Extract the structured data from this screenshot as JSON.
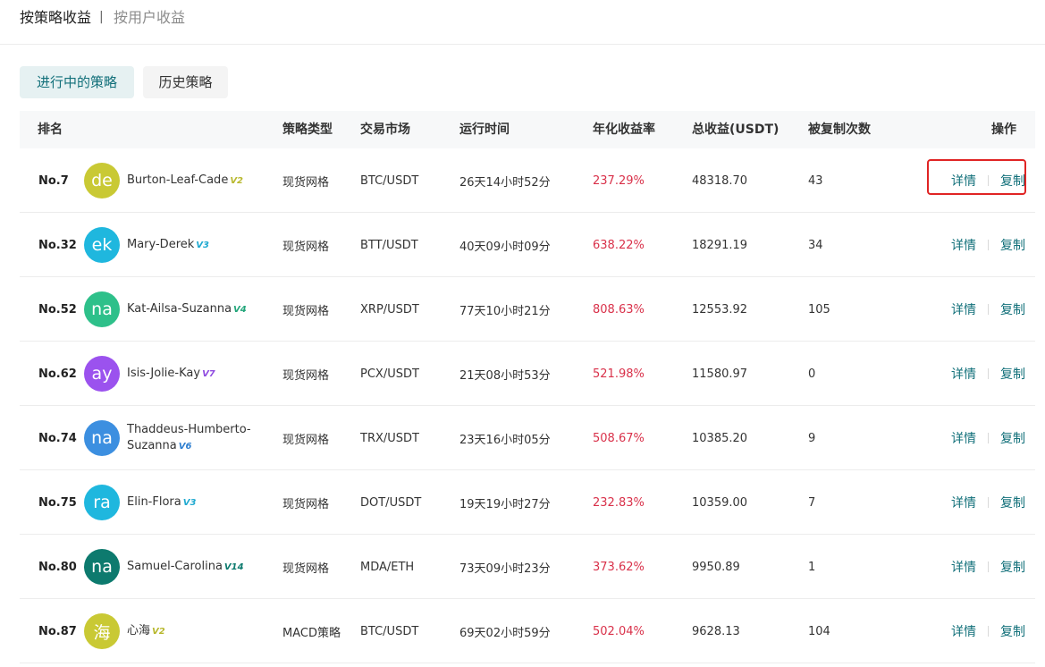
{
  "nav": {
    "by_strategy": "按策略收益",
    "separator": "|",
    "by_user": "按用户收益"
  },
  "tabs": {
    "active": "进行中的策略",
    "history": "历史策略"
  },
  "headers": {
    "rank": "排名",
    "type": "策略类型",
    "market": "交易市场",
    "time": "运行时间",
    "rate": "年化收益率",
    "total": "总收益(USDT)",
    "copies": "被复制次数",
    "ops": "操作"
  },
  "actions": {
    "detail": "详情",
    "copy": "复制"
  },
  "rows": [
    {
      "rank": "No.7",
      "initials": "de",
      "avatar_color": "#c9c934",
      "badge_color": "#b8b82e",
      "name": "Burton-Leaf-Cade",
      "badge": "V2",
      "type": "现货网格",
      "market": "BTC/USDT",
      "time": "26天14小时52分",
      "rate": "237.29%",
      "total": "48318.70",
      "copies": "43"
    },
    {
      "rank": "No.32",
      "initials": "ek",
      "avatar_color": "#1fb7de",
      "badge_color": "#1fa9d0",
      "name": "Mary-Derek",
      "badge": "V3",
      "type": "现货网格",
      "market": "BTT/USDT",
      "time": "40天09小时09分",
      "rate": "638.22%",
      "total": "18291.19",
      "copies": "34"
    },
    {
      "rank": "No.52",
      "initials": "na",
      "avatar_color": "#2ec08a",
      "badge_color": "#22a57a",
      "name": "Kat-Ailsa-Suzanna",
      "badge": "V4",
      "type": "现货网格",
      "market": "XRP/USDT",
      "time": "77天10小时21分",
      "rate": "808.63%",
      "total": "12553.92",
      "copies": "105"
    },
    {
      "rank": "No.62",
      "initials": "ay",
      "avatar_color": "#9b52ee",
      "badge_color": "#8f4be0",
      "name": "Isis-Jolie-Kay",
      "badge": "V7",
      "type": "现货网格",
      "market": "PCX/USDT",
      "time": "21天08小时53分",
      "rate": "521.98%",
      "total": "11580.97",
      "copies": "0"
    },
    {
      "rank": "No.74",
      "initials": "na",
      "avatar_color": "#3c8fe0",
      "badge_color": "#2f7fd0",
      "name": "Thaddeus-Humberto-Suzanna",
      "badge": "V6",
      "type": "现货网格",
      "market": "TRX/USDT",
      "time": "23天16小时05分",
      "rate": "508.67%",
      "total": "10385.20",
      "copies": "9"
    },
    {
      "rank": "No.75",
      "initials": "ra",
      "avatar_color": "#1fb7de",
      "badge_color": "#1fa9d0",
      "name": "Elin-Flora",
      "badge": "V3",
      "type": "现货网格",
      "market": "DOT/USDT",
      "time": "19天19小时27分",
      "rate": "232.83%",
      "total": "10359.00",
      "copies": "7"
    },
    {
      "rank": "No.80",
      "initials": "na",
      "avatar_color": "#0d7a6e",
      "badge_color": "#0d7a6e",
      "name": "Samuel-Carolina",
      "badge": "V14",
      "type": "现货网格",
      "market": "MDA/ETH",
      "time": "73天09小时23分",
      "rate": "373.62%",
      "total": "9950.89",
      "copies": "1"
    },
    {
      "rank": "No.87",
      "initials": "海",
      "avatar_color": "#c9c934",
      "badge_color": "#b8b82e",
      "name": "心海",
      "badge": "V2",
      "type": "MACD策略",
      "market": "BTC/USDT",
      "time": "69天02小时59分",
      "rate": "502.04%",
      "total": "9628.13",
      "copies": "104"
    }
  ]
}
